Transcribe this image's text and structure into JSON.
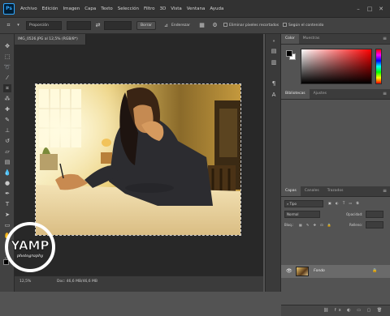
{
  "app": {
    "logo_text": "Ps"
  },
  "menu": [
    "Archivo",
    "Edición",
    "Imagen",
    "Capa",
    "Texto",
    "Selección",
    "Filtro",
    "3D",
    "Vista",
    "Ventana",
    "Ayuda"
  ],
  "window_controls": {
    "minimize": "–",
    "restore": "□",
    "close": "✕"
  },
  "options_bar": {
    "ratio_value": "Proporción",
    "swap_icon": "⇄",
    "clear_label": "Borrar",
    "straighten_label": "Enderezar",
    "delete_pixels_label": "Eliminar píxeles recortados",
    "content_aware_label": "Según el contenido"
  },
  "document": {
    "tab_title": "IMG_0526.JPG al 12,5% (RGB/8*)",
    "zoom": "12,5%",
    "doc_info": "Doc: 46,6 MB/46,6 MB"
  },
  "panels": {
    "color_tabs": [
      "Color",
      "Muestras"
    ],
    "library_tabs": [
      "Bibliotecas",
      "Ajustes"
    ],
    "layers_tabs": [
      "Capas",
      "Canales",
      "Trazados"
    ],
    "layer_filter_placeholder": "Tipo",
    "blend_mode": "Normal",
    "opacity_label": "Opacidad:",
    "lock_label": "Bloq.:",
    "fill_label": "Relleno:",
    "layers": [
      {
        "name": "Fondo",
        "visible": true,
        "locked": true
      }
    ]
  },
  "watermark": {
    "brand": "YAMP",
    "tagline": "photography"
  },
  "colors": {
    "accent": "#31a8ff",
    "foreground": "#000000",
    "background": "#ffffff"
  }
}
